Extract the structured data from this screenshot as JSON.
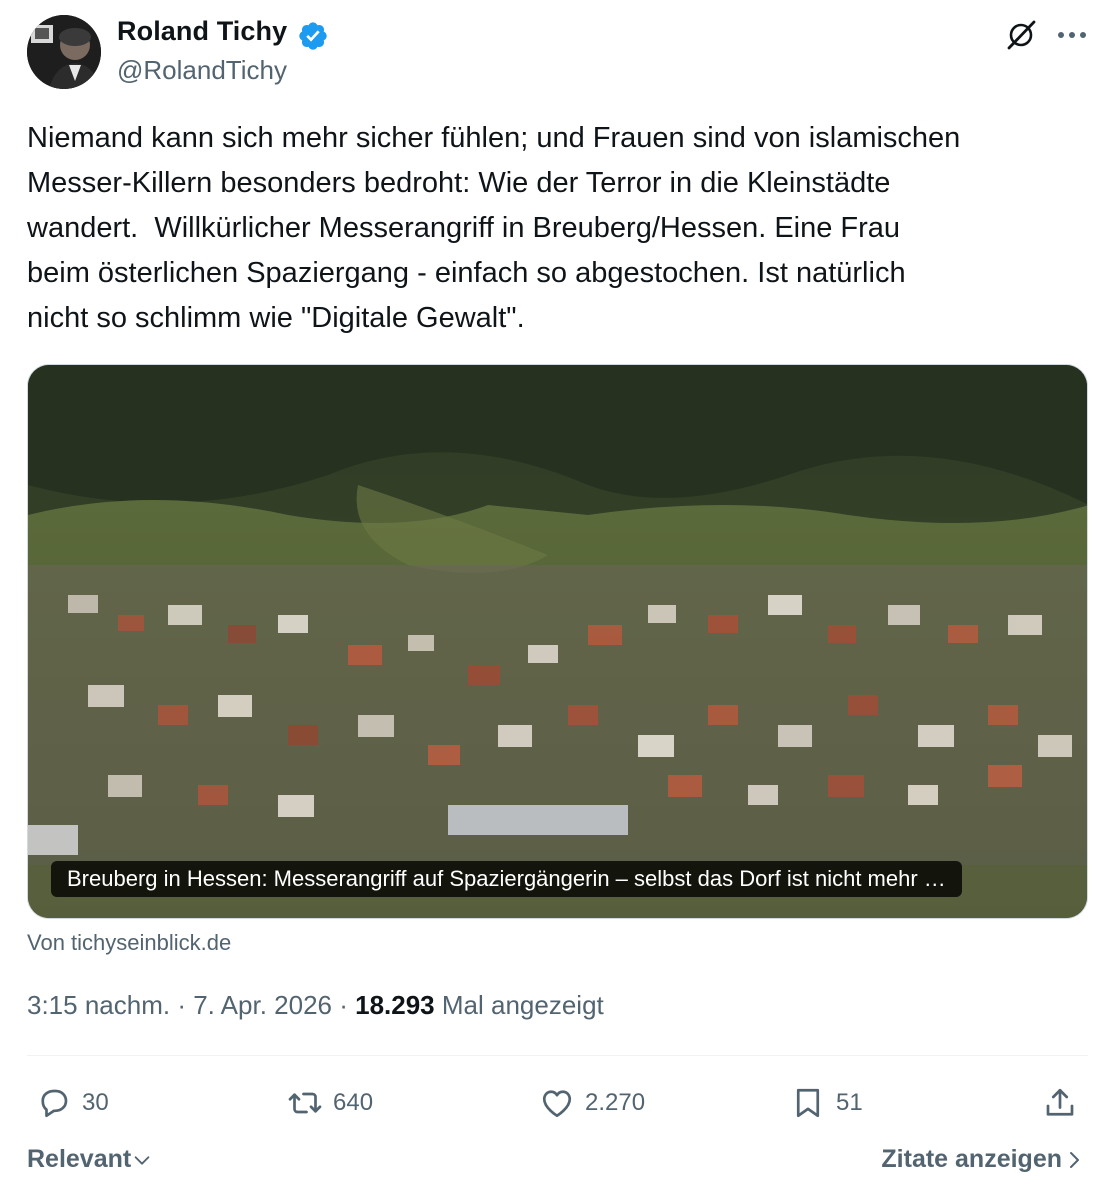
{
  "author": {
    "display_name": "Roland Tichy",
    "handle": "@RolandTichy",
    "verified": true,
    "verified_color": "#1d9bf0"
  },
  "header_icons": [
    "grok-icon",
    "more-options-icon"
  ],
  "tweet": {
    "text": "Niemand kann sich mehr sicher fühlen; und Frauen sind von islamischen\nMesser-Killern besonders bedroht: Wie der Terror in die Kleinstädte\nwandert.  Willkürlicher Messerangriff in Breuberg/Hessen. Eine Frau\nbeim österlichen Spaziergang - einfach so abgestochen. Ist natürlich\nnicht so schlimm wie \"Digitale Gewalt\"."
  },
  "link_card": {
    "caption": "Breuberg in Hessen: Messerangriff auf Spaziergängerin – selbst das Dorf ist nicht mehr …",
    "source": "Von tichyseinblick.de"
  },
  "meta": {
    "time": "3:15 nachm.",
    "separator": " · ",
    "date": "7. Apr. 2026",
    "views_count": "18.293",
    "views_label": "Mal angezeigt"
  },
  "actions": {
    "replies": "30",
    "reposts": "640",
    "likes": "2.270",
    "bookmarks": "51"
  },
  "footer": {
    "sort_label": "Relevant",
    "quotes_label": "Zitate anzeigen"
  },
  "colors": {
    "text_primary": "#0f1419",
    "text_secondary": "#536471",
    "divider": "#eff3f4"
  }
}
